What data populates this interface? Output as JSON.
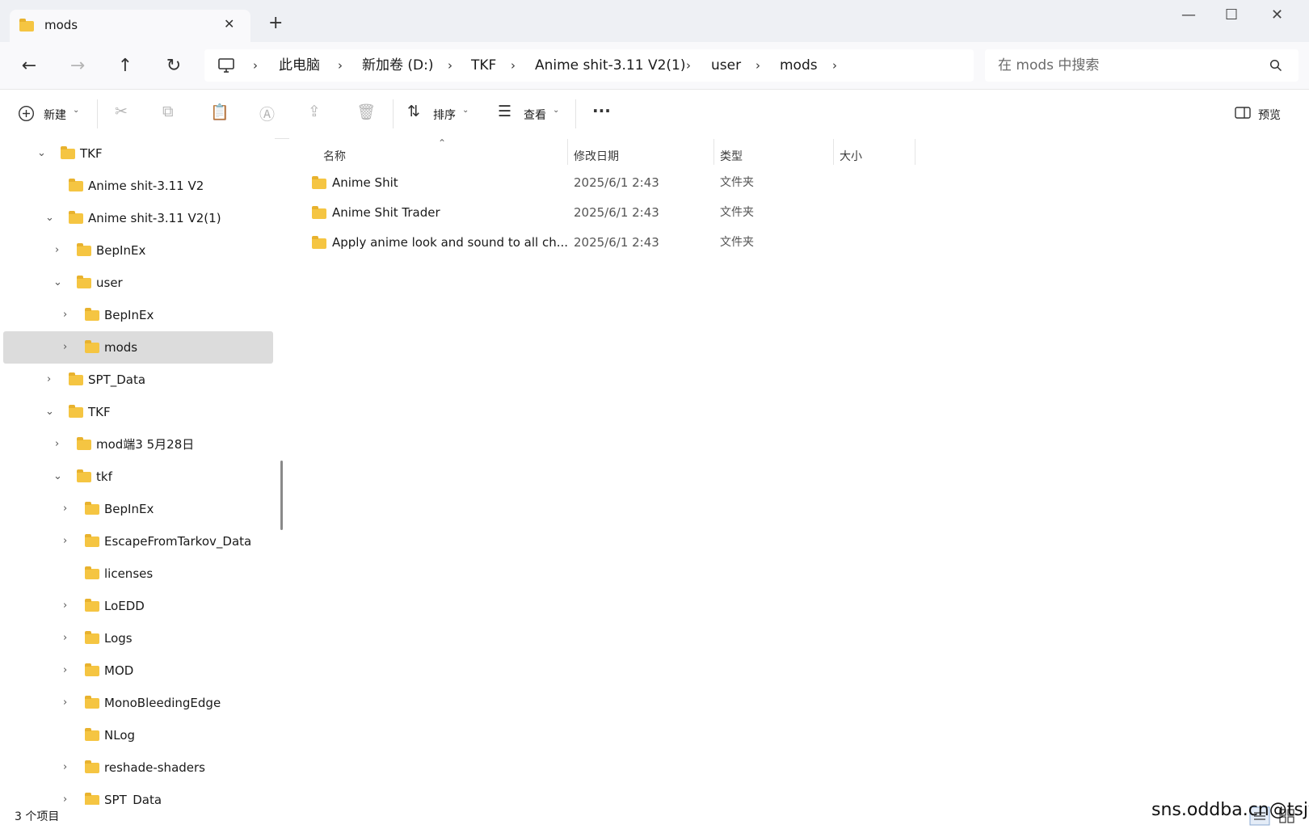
{
  "window": {
    "tab_title": "mods",
    "tab_close": "✕",
    "new_tab": "+",
    "minimize": "—",
    "maximize": "☐",
    "close": "✕"
  },
  "nav": {
    "back": "←",
    "forward": "→",
    "up": "↑",
    "refresh": "↻",
    "breadcrumbs": [
      "此电脑",
      "新加卷 (D:)",
      "TKF",
      "Anime shit-3.11 V2(1)",
      "user",
      "mods"
    ],
    "search_placeholder": "在 mods 中搜索"
  },
  "toolbar": {
    "new_label": "新建",
    "sort_label": "排序",
    "view_label": "查看",
    "more": "···",
    "preview_label": "预览"
  },
  "sidebar": {
    "items": [
      {
        "label": "TKF",
        "expanded": true
      },
      {
        "label": "Anime shit-3.11 V2"
      },
      {
        "label": "Anime shit-3.11 V2(1)",
        "expanded": true
      },
      {
        "label": "BepInEx",
        "expanded": false
      },
      {
        "label": "user",
        "expanded": true
      },
      {
        "label": "BepInEx",
        "expanded": false
      },
      {
        "label": "mods",
        "expanded": false,
        "selected": true
      },
      {
        "label": "SPT_Data",
        "expanded": false
      },
      {
        "label": "TKF",
        "expanded": true
      },
      {
        "label": "mod端3 5月28日",
        "expanded": false
      },
      {
        "label": "tkf",
        "expanded": true
      },
      {
        "label": "BepInEx",
        "expanded": false
      },
      {
        "label": "EscapeFromTarkov_Data",
        "expanded": false
      },
      {
        "label": "licenses"
      },
      {
        "label": "LoEDD",
        "expanded": false
      },
      {
        "label": "Logs",
        "expanded": false
      },
      {
        "label": "MOD",
        "expanded": false
      },
      {
        "label": "MonoBleedingEdge",
        "expanded": false
      },
      {
        "label": "NLog"
      },
      {
        "label": "reshade-shaders",
        "expanded": false
      },
      {
        "label": "SPT_Data",
        "expanded": false
      }
    ]
  },
  "table": {
    "columns": [
      "名称",
      "修改日期",
      "类型",
      "大小"
    ],
    "rows": [
      {
        "name": "Anime Shit",
        "date": "2025/6/1 2:43",
        "type": "文件夹",
        "size": ""
      },
      {
        "name": "Anime Shit Trader",
        "date": "2025/6/1 2:43",
        "type": "文件夹",
        "size": ""
      },
      {
        "name": "Apply anime look and sound to all ch...",
        "date": "2025/6/1 2:43",
        "type": "文件夹",
        "size": ""
      }
    ]
  },
  "status": {
    "item_count": "3 个项目",
    "watermark": "sns.oddba.cn@tsjy"
  },
  "colors": {
    "folder": "#f5c542",
    "selection": "#dcdcdc",
    "titlebar": "#eef0f4"
  }
}
